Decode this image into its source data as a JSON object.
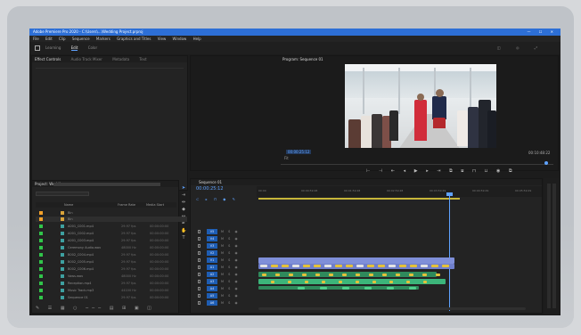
{
  "window": {
    "title": "Adobe Premiere Pro 2020 - C:\\Users\\...\\Wedding Project.prproj",
    "controls": "—  ☐  ✕"
  },
  "menu": [
    "File",
    "Edit",
    "Clip",
    "Sequence",
    "Markers",
    "Graphics and Titles",
    "View",
    "Window",
    "Help"
  ],
  "workspace": {
    "tabs": [
      "Learning",
      "Edit",
      "Color"
    ],
    "active": "Edit"
  },
  "source_panel": {
    "tabs": [
      "Effect Controls",
      "Audio Track Mixer",
      "Metadata",
      "Text"
    ]
  },
  "program_monitor": {
    "tab": "Program: Sequence 01",
    "timecode": "00:00:25:12",
    "fit": "Fit",
    "duration": "00:10:48:22",
    "transport_icons": [
      "mark-in",
      "mark-out",
      "go-to-in",
      "step-back",
      "play",
      "step-forward",
      "go-to-out",
      "insert",
      "overwrite",
      "lift",
      "extract",
      "export-frame",
      "compare"
    ]
  },
  "project_panel": {
    "tab": "Project: Wedding",
    "search_placeholder": "",
    "columns": [
      "Name",
      "Frame Rate",
      "Media Start"
    ],
    "folders": [
      "Bin",
      "Bin"
    ],
    "rows": [
      {
        "name": "A001_C001.mp4",
        "rate": "29.97 fps",
        "start": "00:00:00:00",
        "color": "green"
      },
      {
        "name": "A001_C002.mp4",
        "rate": "29.97 fps",
        "start": "00:00:00:00",
        "color": "green"
      },
      {
        "name": "A001_C003.mp4",
        "rate": "29.97 fps",
        "start": "00:00:00:00",
        "color": "green"
      },
      {
        "name": "Ceremony Audio.wav",
        "rate": "48000 Hz",
        "start": "00:00:00:00",
        "color": "green"
      },
      {
        "name": "B002_C004.mp4",
        "rate": "29.97 fps",
        "start": "00:00:00:00",
        "color": "green"
      },
      {
        "name": "B002_C005.mp4",
        "rate": "29.97 fps",
        "start": "00:00:00:00",
        "color": "green"
      },
      {
        "name": "B002_C006.mp4",
        "rate": "29.97 fps",
        "start": "00:00:00:00",
        "color": "green"
      },
      {
        "name": "Vows.wav",
        "rate": "48000 Hz",
        "start": "00:00:00:00",
        "color": "green"
      },
      {
        "name": "Reception.mp4",
        "rate": "29.97 fps",
        "start": "00:00:00:00",
        "color": "green"
      },
      {
        "name": "Music Track.mp3",
        "rate": "44100 Hz",
        "start": "00:00:00:00",
        "color": "green"
      },
      {
        "name": "Sequence 01",
        "rate": "29.97 fps",
        "start": "00:00:00:00",
        "color": "green"
      }
    ]
  },
  "timeline": {
    "tab": "Sequence 01",
    "timecode": "00:00:25:12",
    "ruler": [
      "00:00",
      "00:00:59:28",
      "00:01:59:28",
      "00:02:59:28",
      "00:03:59:29",
      "00:04:59:29",
      "00:05:59:29"
    ],
    "video_tracks": [
      "V5",
      "V4",
      "V3",
      "V2",
      "V1"
    ],
    "audio_tracks": [
      "A1",
      "A2",
      "A3",
      "A4",
      "A5",
      "A6"
    ]
  },
  "colors": {
    "accent": "#5fa2ff",
    "titlebar": "#2d6fd6",
    "clip_video": "#7f8fd9",
    "clip_audio": "#3cb57a",
    "clip_yellow": "#e4c23a"
  }
}
